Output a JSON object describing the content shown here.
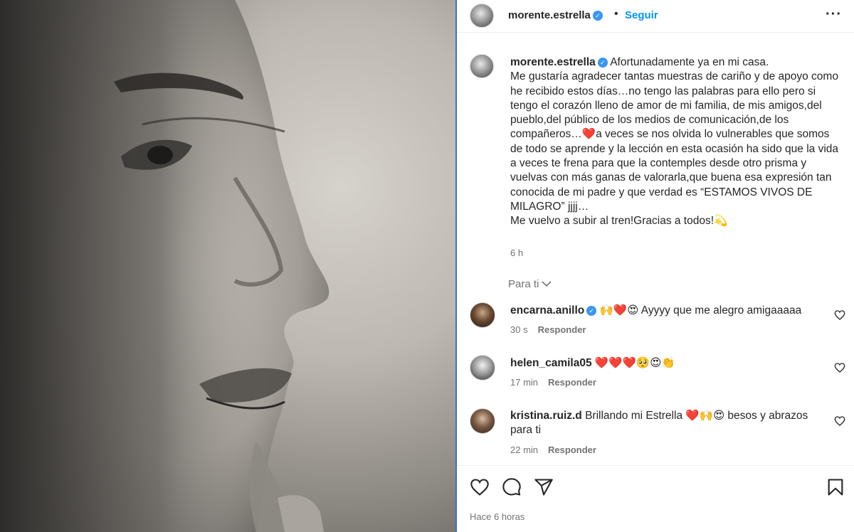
{
  "header": {
    "username": "morente.estrella",
    "separator": "•",
    "follow_label": "Seguir",
    "more_label": "···"
  },
  "caption": {
    "username": "morente.estrella",
    "lines": [
      "Afortunadamente ya en mi casa.",
      "Me gustaría agradecer tantas muestras de cariño y de apoyo como he recibido estos días…no tengo las palabras para ello pero si tengo el corazón lleno de amor de mi familia, de mis amigos,del pueblo,del público de los medios de comunicación,de los compañeros…❤️a veces se nos olvida lo vulnerables que somos",
      "de todo se aprende y la lección en esta ocasión ha sido que la vida a veces te frena para que la contemples desde otro prisma y vuelvas con más ganas de valorarla,que buena esa expresión tan conocida de mi padre y que verdad es “ESTAMOS VIVOS DE MILAGRO” jjjj…",
      "Me vuelvo a subir al tren!Gracias a todos!💫"
    ],
    "time": "6 h"
  },
  "filter": {
    "label": "Para ti"
  },
  "comments": [
    {
      "username": "encarna.anillo",
      "verified": true,
      "text": "🙌❤️😍 Ayyyy que me alegro amigaaaaa",
      "time": "30 s",
      "reply_label": "Responder"
    },
    {
      "username": "helen_camila05",
      "verified": false,
      "text": "❤️❤️❤️🥺😍👏",
      "time": "17 min",
      "reply_label": "Responder"
    },
    {
      "username": "kristina.ruiz.d",
      "verified": false,
      "text": "Brillando mi Estrella ❤️🙌😍 besos y abrazos para ti",
      "time": "22 min",
      "reply_label": "Responder"
    }
  ],
  "footer": {
    "timestamp": "Hace 6 horas"
  },
  "icons": {
    "like": "heart-icon",
    "comment": "comment-icon",
    "share": "send-icon",
    "save": "bookmark-icon",
    "verified": "verified-badge-icon",
    "more": "more-options-icon"
  },
  "colors": {
    "accent": "#0095f6",
    "verified": "#3897f0",
    "text": "#262626",
    "muted": "#737373"
  }
}
